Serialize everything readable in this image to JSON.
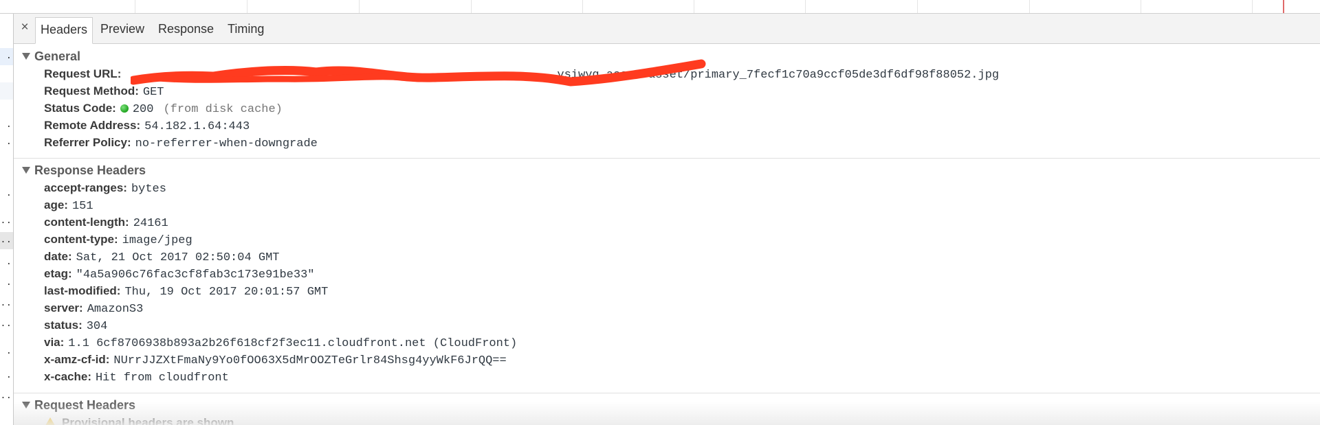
{
  "tabs": {
    "close_label": "×",
    "items": [
      "Headers",
      "Preview",
      "Response",
      "Timing"
    ],
    "active": "Headers"
  },
  "general": {
    "title": "General",
    "request_url": {
      "key": "Request URL:",
      "value": "https://.../media-.../production/.../wysiwyg_asset/asset/primary_7fecf1c70a9ccf05de3df6df98f88052.jpg",
      "visible_tail": "ysiwyg_asset/asset/primary_7fecf1c70a9ccf05de3df6df98f88052.jpg"
    },
    "request_method": {
      "key": "Request Method:",
      "value": "GET"
    },
    "status_code": {
      "key": "Status Code:",
      "value": "200",
      "note": "(from disk cache)",
      "status_color": "#22aa22"
    },
    "remote_address": {
      "key": "Remote Address:",
      "value": "54.182.1.64:443"
    },
    "referrer_policy": {
      "key": "Referrer Policy:",
      "value": "no-referrer-when-downgrade"
    }
  },
  "response_headers": {
    "title": "Response Headers",
    "rows": [
      {
        "key": "accept-ranges:",
        "value": "bytes"
      },
      {
        "key": "age:",
        "value": "151"
      },
      {
        "key": "content-length:",
        "value": "24161"
      },
      {
        "key": "content-type:",
        "value": "image/jpeg"
      },
      {
        "key": "date:",
        "value": "Sat, 21 Oct 2017 02:50:04 GMT"
      },
      {
        "key": "etag:",
        "value": "\"4a5a906c76fac3cf8fab3c173e91be33\""
      },
      {
        "key": "last-modified:",
        "value": "Thu, 19 Oct 2017 20:01:57 GMT"
      },
      {
        "key": "server:",
        "value": "AmazonS3"
      },
      {
        "key": "status:",
        "value": "304"
      },
      {
        "key": "via:",
        "value": "1.1 6cf8706938b893a2b26f618cf2f3ec11.cloudfront.net (CloudFront)"
      },
      {
        "key": "x-amz-cf-id:",
        "value": "NUrrJJZXtFmaNy9Yo0fOO63X5dMrOOZTeGrlr84Shsg4yyWkF6JrQQ=="
      },
      {
        "key": "x-cache:",
        "value": "Hit from cloudfront"
      }
    ]
  },
  "request_headers": {
    "title": "Request Headers",
    "warning": "Provisional headers are shown"
  },
  "colors": {
    "redaction": "#ff3b1f",
    "timeline_marker": "#e06a6a",
    "warning": "#f2b705"
  }
}
